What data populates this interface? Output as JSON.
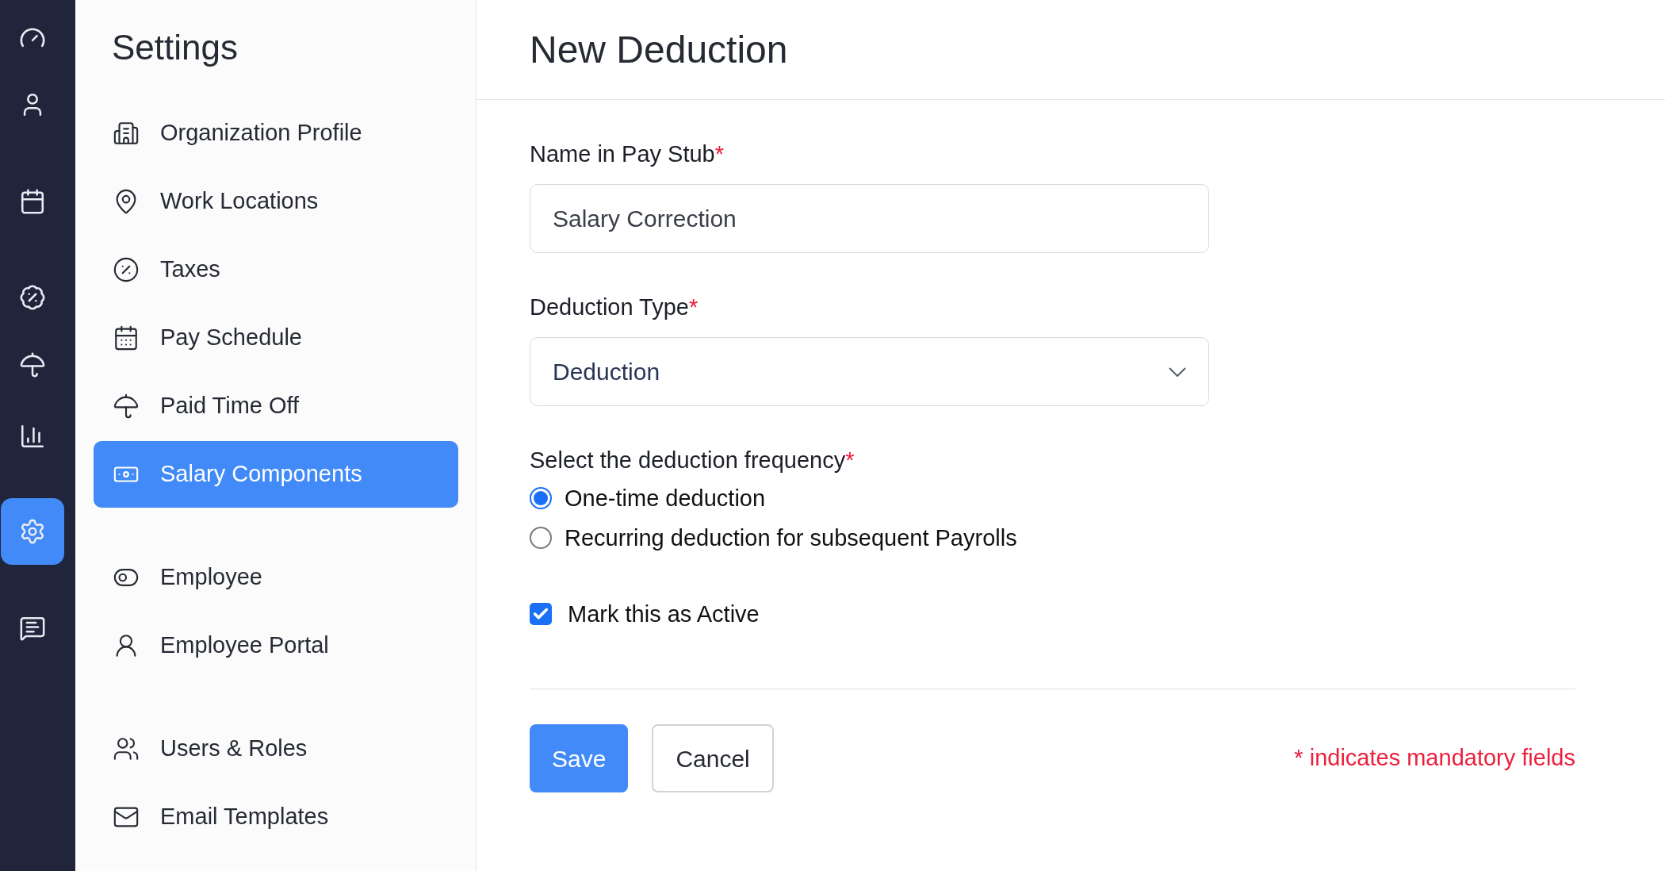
{
  "rail": [
    {
      "kind": "dashboard",
      "selected": false
    },
    {
      "kind": "person",
      "selected": false
    },
    {
      "kind": "calendar",
      "selected": false
    },
    {
      "kind": "percent",
      "selected": false
    },
    {
      "kind": "umbrella",
      "selected": false
    },
    {
      "kind": "chart",
      "selected": false
    },
    {
      "kind": "settings",
      "selected": true
    },
    {
      "kind": "message",
      "selected": false
    }
  ],
  "sidebar": {
    "title": "Settings",
    "sections": [
      {
        "items": [
          {
            "label": "Organization Profile",
            "kind": "building",
            "selected": false
          },
          {
            "label": "Work Locations",
            "kind": "pin",
            "selected": false
          },
          {
            "label": "Taxes",
            "kind": "percent",
            "selected": false
          },
          {
            "label": "Pay Schedule",
            "kind": "calendar",
            "selected": false
          },
          {
            "label": "Paid Time Off",
            "kind": "umbrella",
            "selected": false
          },
          {
            "label": "Salary Components",
            "kind": "banknote",
            "selected": true
          }
        ]
      },
      {
        "items": [
          {
            "label": "Employee",
            "kind": "toggle",
            "selected": false
          },
          {
            "label": "Employee Portal",
            "kind": "person",
            "selected": false
          }
        ]
      },
      {
        "items": [
          {
            "label": "Users & Roles",
            "kind": "users",
            "selected": false
          },
          {
            "label": "Email Templates",
            "kind": "mail",
            "selected": false
          }
        ]
      }
    ]
  },
  "page": {
    "title": "New Deduction"
  },
  "form": {
    "fields": [
      {
        "kind": "text",
        "label": "Name in Pay Stub",
        "marker": "*",
        "value": "Salary Correction"
      },
      {
        "kind": "select",
        "label": "Deduction Type",
        "marker": "*",
        "value": "Deduction"
      }
    ],
    "frequency": {
      "label": "Select the deduction frequency",
      "marker": "*",
      "options": [
        {
          "label": "One-time deduction",
          "selected": true
        },
        {
          "label": "Recurring deduction for subsequent Payrolls",
          "selected": false
        }
      ]
    },
    "active": {
      "label": "Mark this as Active",
      "checked": true
    },
    "buttons": [
      {
        "label": "Save",
        "kind": "primary"
      },
      {
        "label": "Cancel",
        "kind": "secondary"
      }
    ],
    "mandatory_note": "* indicates mandatory fields"
  }
}
